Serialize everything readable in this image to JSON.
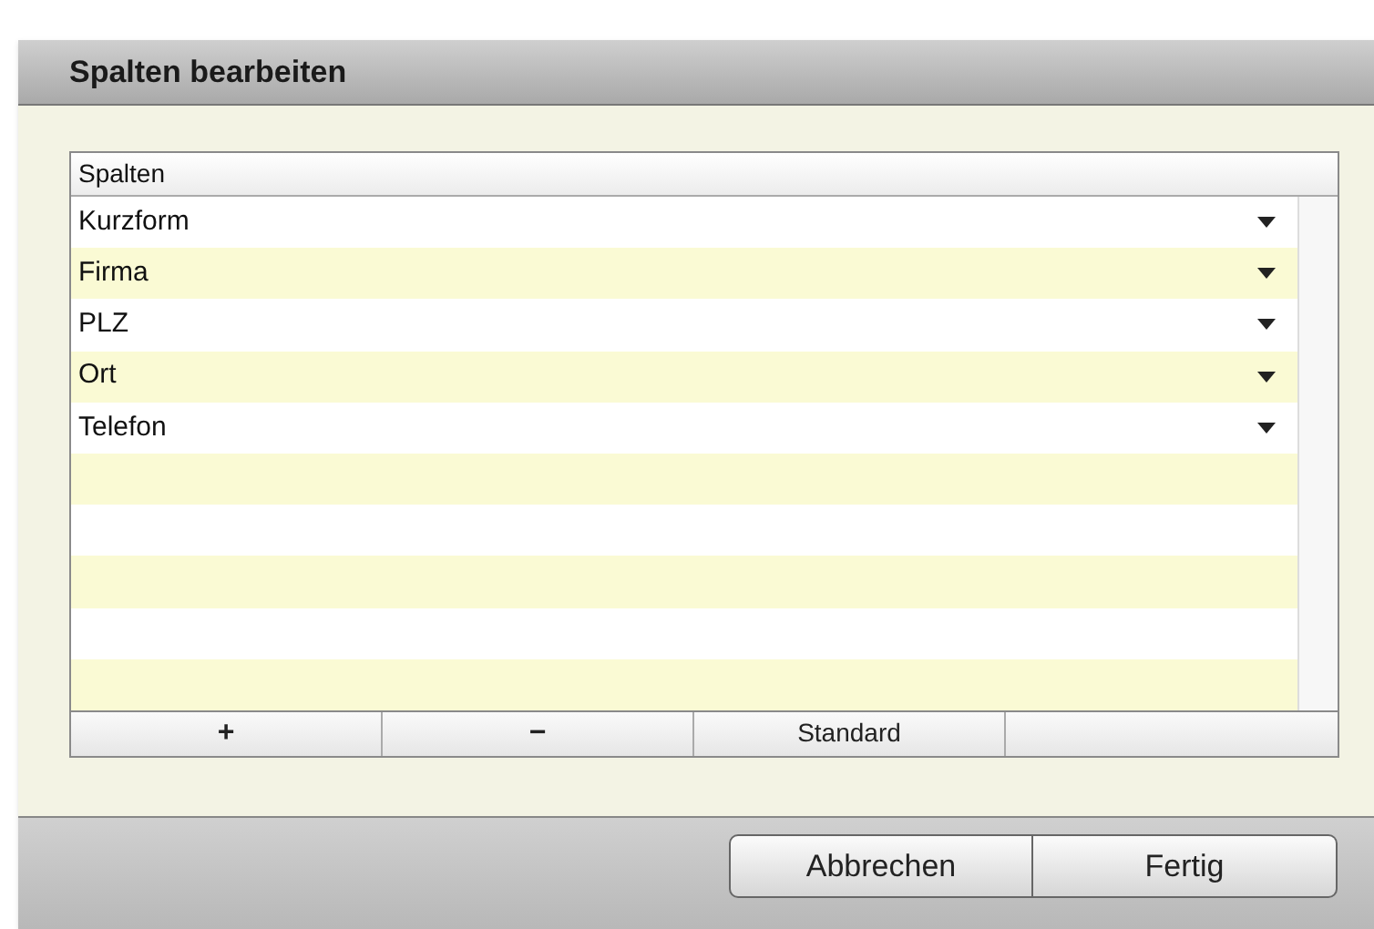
{
  "dialog": {
    "title": "Spalten bearbeiten"
  },
  "table": {
    "header": "Spalten",
    "rows": [
      {
        "label": "Kurzform"
      },
      {
        "label": "Firma"
      },
      {
        "label": "PLZ"
      },
      {
        "label": "Ort"
      },
      {
        "label": "Telefon"
      }
    ],
    "toolbar": [
      "+",
      "−",
      "Standard"
    ]
  },
  "buttons": [
    "Abbrechen",
    "Fertig"
  ]
}
